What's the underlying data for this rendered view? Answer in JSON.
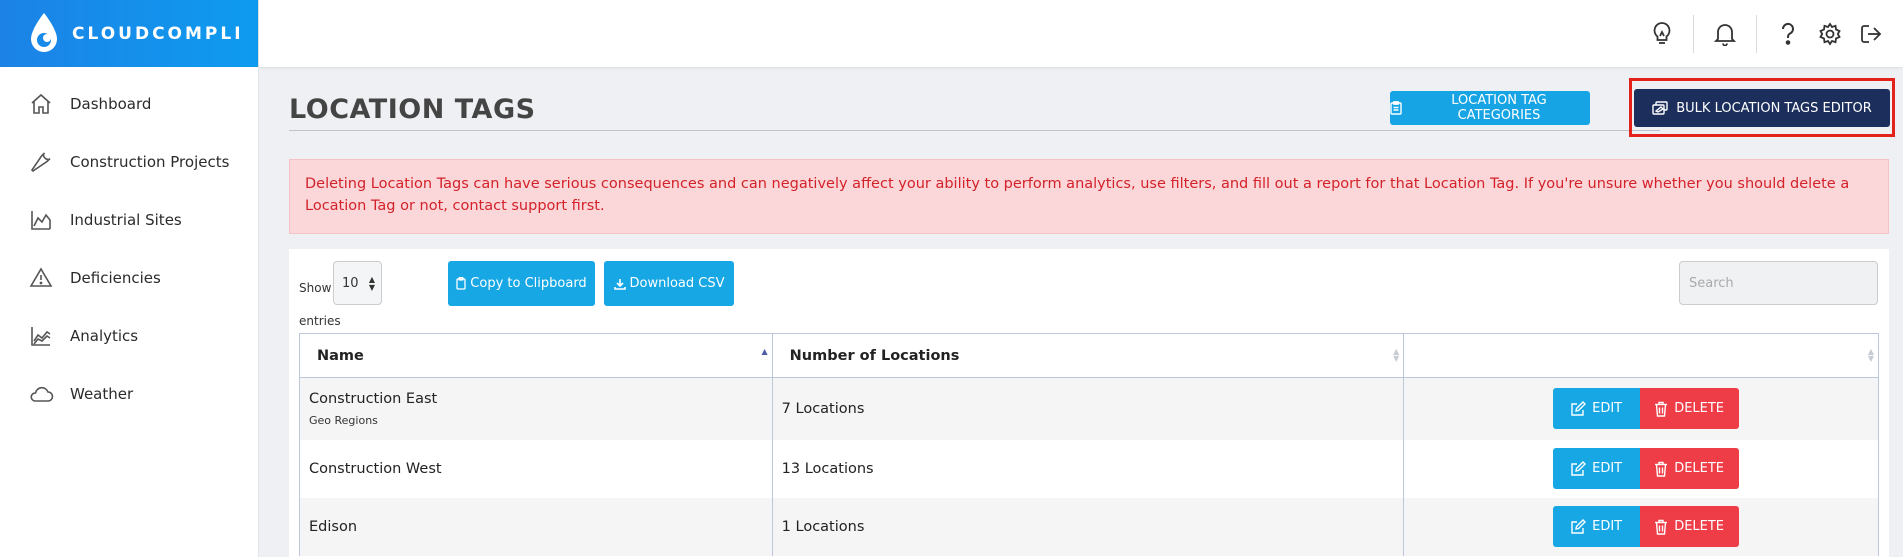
{
  "brand": {
    "name": "CLOUDCOMPLI"
  },
  "sidebar": {
    "items": [
      {
        "label": "Dashboard",
        "icon": "home-icon"
      },
      {
        "label": "Construction Projects",
        "icon": "wrench-icon"
      },
      {
        "label": "Industrial Sites",
        "icon": "area-chart-icon"
      },
      {
        "label": "Deficiencies",
        "icon": "warning-icon"
      },
      {
        "label": "Analytics",
        "icon": "analytics-icon"
      },
      {
        "label": "Weather",
        "icon": "cloud-icon"
      }
    ]
  },
  "topbar": {
    "icons": [
      "lightbulb-icon",
      "bell-icon",
      "help-icon",
      "gear-icon",
      "logout-icon"
    ]
  },
  "page": {
    "title": "LOCATION TAGS",
    "categories_button": "LOCATION TAG CATEGORIES",
    "bulk_button": "BULK LOCATION TAGS EDITOR"
  },
  "alert": {
    "text": "Deleting Location Tags can have serious consequences and can negatively affect your ability to perform analytics, use filters, and fill out a report for that Location Tag. If you're unsure whether you should delete a Location Tag or not, contact support first."
  },
  "table_controls": {
    "show_label": "Show",
    "length_value": "10",
    "entries_label": "entries",
    "copy_button": "Copy to Clipboard",
    "csv_button": "Download CSV",
    "search_placeholder": "Search"
  },
  "table": {
    "columns": [
      "Name",
      "Number of Locations",
      ""
    ],
    "rows": [
      {
        "name": "Construction East",
        "category": "Geo Regions",
        "locations": "7 Locations"
      },
      {
        "name": "Construction West",
        "category": "",
        "locations": "13 Locations"
      },
      {
        "name": "Edison",
        "category": "",
        "locations": "1 Locations"
      }
    ],
    "edit_label": "EDIT",
    "delete_label": "DELETE"
  },
  "colors": {
    "brand_blue": "#1c82e6",
    "button_blue": "#16a7e4",
    "navy": "#1c2f5c",
    "danger": "#ee3d46",
    "highlight": "#e3231b"
  }
}
